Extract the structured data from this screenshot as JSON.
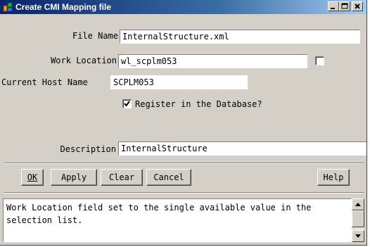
{
  "window": {
    "title": "Create CMI Mapping file"
  },
  "form": {
    "file_name_label": "File Name",
    "file_name_value": "InternalStructure.xml",
    "work_location_label": "Work Location",
    "work_location_value": "wl_scplm053",
    "host_label": "Current Host Name",
    "host_value": "SCPLM053",
    "register_label": "Register in the Database?",
    "register_checked": true,
    "work_location_checkbox_checked": false,
    "description_label": "Description",
    "description_value": "InternalStructure"
  },
  "buttons": {
    "ok": "OK",
    "apply": "Apply",
    "clear": "Clear",
    "cancel": "Cancel",
    "help": "Help"
  },
  "status": {
    "message": "Work Location field set to the single available value in the selection list."
  },
  "colors": {
    "titlebar_start": "#0a246a",
    "titlebar_end": "#a6caf0",
    "dialog_bg": "#d4d0c8"
  },
  "icons": [
    "app-icon",
    "minimize-icon",
    "maximize-icon",
    "close-icon",
    "checkmark-icon",
    "scroll-up-icon",
    "scroll-down-icon"
  ]
}
